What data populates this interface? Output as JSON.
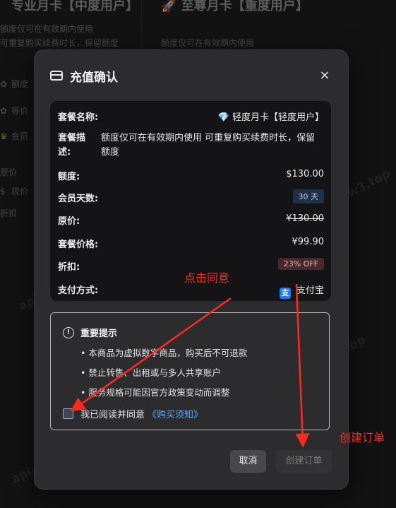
{
  "background": {
    "left_card": {
      "title": "专业月卡【中度用户】",
      "desc1": "额度仅可在有效期内使用",
      "desc2": "可重复购买续费时长，保留额度",
      "list": [
        "额度",
        "等价",
        "会员",
        "原价",
        "现价",
        "折扣"
      ]
    },
    "right_card": {
      "title": "至尊月卡【重度用户】",
      "desc1": "额度仅可在有效期内使用"
    }
  },
  "modal": {
    "title": "充值确认",
    "close_icon": "×",
    "labels": {
      "plan_name": "套餐名称:",
      "plan_desc": "套餐描述:",
      "quota": "额度:",
      "member_days": "会员天数:",
      "original_price": "原价:",
      "plan_price": "套餐价格:",
      "discount": "折扣:",
      "payment": "支付方式:"
    },
    "values": {
      "plan_icon": "💎",
      "plan_name": "轻度月卡【轻度用户】",
      "plan_desc": "额度仅可在有效期内使用 可重复购买续费时长，保留额度",
      "quota": "$130.00",
      "member_days": "30 天",
      "original_price": "¥130.00",
      "plan_price": "¥99.90",
      "discount": "23% OFF",
      "payment_icon": "支",
      "payment": "支付宝"
    },
    "notice": {
      "icon": "!",
      "title": "重要提示",
      "items": [
        "• 本商品为虚拟数字商品，购买后不可退款",
        "• 禁止转售、出租或与多人共享账户",
        "• 服务规格可能因官方政策变动而调整"
      ],
      "agree_text": "我已阅读并同意",
      "terms_link": "《购买须知》"
    },
    "buttons": {
      "cancel": "取消",
      "create": "创建订单"
    }
  },
  "annotations": {
    "click_agree": "点击同意",
    "create_order": "创建订单",
    "color": "#ff2a1f"
  },
  "watermark": "api.wow3.top"
}
